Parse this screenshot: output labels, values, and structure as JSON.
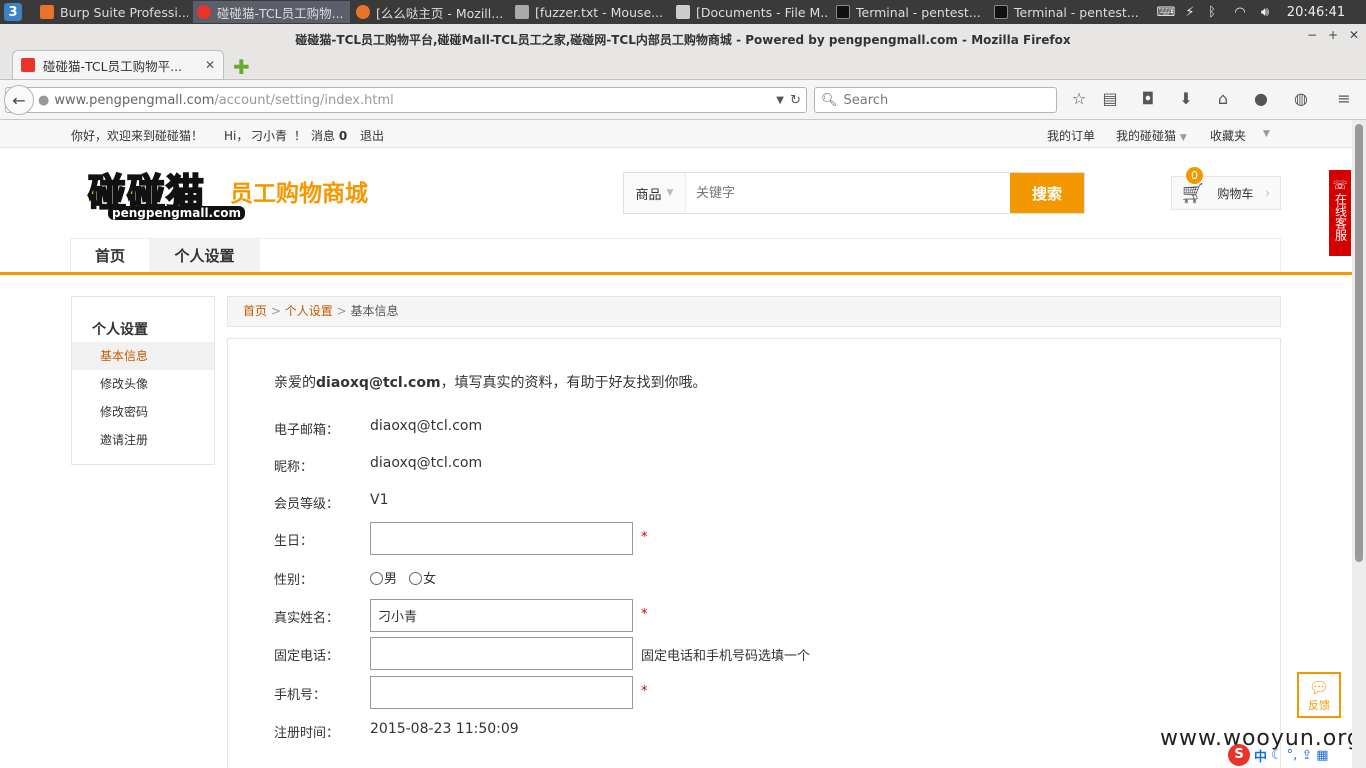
{
  "taskbar": {
    "items": [
      {
        "label": "Burp Suite Professi...",
        "color": "#e8732a"
      },
      {
        "label": "碰碰猫-TCL员工购物...",
        "color": "#e8342a"
      },
      {
        "label": "[么么哒主页 - Mozill...",
        "color": "#e8732a"
      },
      {
        "label": "[fuzzer.txt - Mouse...",
        "color": "#aaaaaa"
      },
      {
        "label": "[Documents - File M...",
        "color": "#cccccc"
      },
      {
        "label": "Terminal - pentest...",
        "color": "#222222"
      },
      {
        "label": "Terminal - pentest...",
        "color": "#222222"
      }
    ],
    "clock": "20:46:41"
  },
  "browser": {
    "window_title": "碰碰猫-TCL员工购物平台,碰碰Mall-TCL员工之家,碰碰网-TCL内部员工购物商城 - Powered by pengpengmall.com - Mozilla Firefox",
    "tab_title": "碰碰猫-TCL员工购物平...",
    "url_host": "www.pengpengmall.com",
    "url_path": "/account/setting/index.html",
    "search_placeholder": "Search"
  },
  "topbar": {
    "welcome": "你好，欢迎来到碰碰猫！",
    "hi": "Hi，",
    "username": "刁小青",
    "exclaim": "！",
    "messages_label": "消息",
    "messages_count": "0",
    "logout": "退出",
    "my_orders": "我的订单",
    "my_pengpengmao": "我的碰碰猫",
    "favorites": "收藏夹"
  },
  "header": {
    "logo_main": "碰碰猫",
    "logo_sub": "员工购物商城",
    "logo_url": "pengpengmall.com",
    "search_category": "商品",
    "search_placeholder": "关键字",
    "search_button": "搜索",
    "cart_label": "购物车",
    "cart_count": "0",
    "online_service": "在线客服"
  },
  "nav": {
    "items": [
      "首页",
      "个人设置"
    ]
  },
  "sidebar": {
    "title": "个人设置",
    "items": [
      "基本信息",
      "修改头像",
      "修改密码",
      "邀请注册"
    ]
  },
  "breadcrumb": {
    "home": "首页",
    "settings": "个人设置",
    "current": "基本信息",
    "sep": ">"
  },
  "form": {
    "intro_prefix": "亲爱的",
    "intro_email": "diaoxq@tcl.com",
    "intro_suffix": "，填写真实的资料，有助于好友找到你哦。",
    "email_label": "电子邮箱：",
    "email_value": "diaoxq@tcl.com",
    "nickname_label": "昵称：",
    "nickname_value": "diaoxq@tcl.com",
    "level_label": "会员等级：",
    "level_value": "V1",
    "birthday_label": "生日：",
    "birthday_value": "",
    "gender_label": "性别：",
    "gender_male": "男",
    "gender_female": "女",
    "realname_label": "真实姓名：",
    "realname_value": "刁小青",
    "phone_label": "固定电话：",
    "phone_value": "",
    "phone_note": "固定电话和手机号码选填一个",
    "mobile_label": "手机号：",
    "mobile_value": "",
    "regtime_label": "注册时间：",
    "regtime_value": "2015-08-23 11:50:09",
    "required_mark": "*"
  },
  "feedback": "反馈",
  "watermark": "www.wooyun.org",
  "ime": "中"
}
